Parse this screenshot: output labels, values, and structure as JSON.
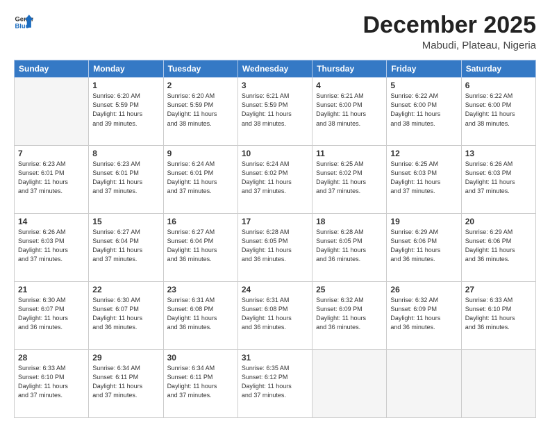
{
  "header": {
    "logo_general": "General",
    "logo_blue": "Blue",
    "month_title": "December 2025",
    "location": "Mabudi, Plateau, Nigeria"
  },
  "weekdays": [
    "Sunday",
    "Monday",
    "Tuesday",
    "Wednesday",
    "Thursday",
    "Friday",
    "Saturday"
  ],
  "weeks": [
    [
      {
        "day": "",
        "info": ""
      },
      {
        "day": "1",
        "info": "Sunrise: 6:20 AM\nSunset: 5:59 PM\nDaylight: 11 hours\nand 39 minutes."
      },
      {
        "day": "2",
        "info": "Sunrise: 6:20 AM\nSunset: 5:59 PM\nDaylight: 11 hours\nand 38 minutes."
      },
      {
        "day": "3",
        "info": "Sunrise: 6:21 AM\nSunset: 5:59 PM\nDaylight: 11 hours\nand 38 minutes."
      },
      {
        "day": "4",
        "info": "Sunrise: 6:21 AM\nSunset: 6:00 PM\nDaylight: 11 hours\nand 38 minutes."
      },
      {
        "day": "5",
        "info": "Sunrise: 6:22 AM\nSunset: 6:00 PM\nDaylight: 11 hours\nand 38 minutes."
      },
      {
        "day": "6",
        "info": "Sunrise: 6:22 AM\nSunset: 6:00 PM\nDaylight: 11 hours\nand 38 minutes."
      }
    ],
    [
      {
        "day": "7",
        "info": "Sunrise: 6:23 AM\nSunset: 6:01 PM\nDaylight: 11 hours\nand 37 minutes."
      },
      {
        "day": "8",
        "info": "Sunrise: 6:23 AM\nSunset: 6:01 PM\nDaylight: 11 hours\nand 37 minutes."
      },
      {
        "day": "9",
        "info": "Sunrise: 6:24 AM\nSunset: 6:01 PM\nDaylight: 11 hours\nand 37 minutes."
      },
      {
        "day": "10",
        "info": "Sunrise: 6:24 AM\nSunset: 6:02 PM\nDaylight: 11 hours\nand 37 minutes."
      },
      {
        "day": "11",
        "info": "Sunrise: 6:25 AM\nSunset: 6:02 PM\nDaylight: 11 hours\nand 37 minutes."
      },
      {
        "day": "12",
        "info": "Sunrise: 6:25 AM\nSunset: 6:03 PM\nDaylight: 11 hours\nand 37 minutes."
      },
      {
        "day": "13",
        "info": "Sunrise: 6:26 AM\nSunset: 6:03 PM\nDaylight: 11 hours\nand 37 minutes."
      }
    ],
    [
      {
        "day": "14",
        "info": "Sunrise: 6:26 AM\nSunset: 6:03 PM\nDaylight: 11 hours\nand 37 minutes."
      },
      {
        "day": "15",
        "info": "Sunrise: 6:27 AM\nSunset: 6:04 PM\nDaylight: 11 hours\nand 37 minutes."
      },
      {
        "day": "16",
        "info": "Sunrise: 6:27 AM\nSunset: 6:04 PM\nDaylight: 11 hours\nand 36 minutes."
      },
      {
        "day": "17",
        "info": "Sunrise: 6:28 AM\nSunset: 6:05 PM\nDaylight: 11 hours\nand 36 minutes."
      },
      {
        "day": "18",
        "info": "Sunrise: 6:28 AM\nSunset: 6:05 PM\nDaylight: 11 hours\nand 36 minutes."
      },
      {
        "day": "19",
        "info": "Sunrise: 6:29 AM\nSunset: 6:06 PM\nDaylight: 11 hours\nand 36 minutes."
      },
      {
        "day": "20",
        "info": "Sunrise: 6:29 AM\nSunset: 6:06 PM\nDaylight: 11 hours\nand 36 minutes."
      }
    ],
    [
      {
        "day": "21",
        "info": "Sunrise: 6:30 AM\nSunset: 6:07 PM\nDaylight: 11 hours\nand 36 minutes."
      },
      {
        "day": "22",
        "info": "Sunrise: 6:30 AM\nSunset: 6:07 PM\nDaylight: 11 hours\nand 36 minutes."
      },
      {
        "day": "23",
        "info": "Sunrise: 6:31 AM\nSunset: 6:08 PM\nDaylight: 11 hours\nand 36 minutes."
      },
      {
        "day": "24",
        "info": "Sunrise: 6:31 AM\nSunset: 6:08 PM\nDaylight: 11 hours\nand 36 minutes."
      },
      {
        "day": "25",
        "info": "Sunrise: 6:32 AM\nSunset: 6:09 PM\nDaylight: 11 hours\nand 36 minutes."
      },
      {
        "day": "26",
        "info": "Sunrise: 6:32 AM\nSunset: 6:09 PM\nDaylight: 11 hours\nand 36 minutes."
      },
      {
        "day": "27",
        "info": "Sunrise: 6:33 AM\nSunset: 6:10 PM\nDaylight: 11 hours\nand 36 minutes."
      }
    ],
    [
      {
        "day": "28",
        "info": "Sunrise: 6:33 AM\nSunset: 6:10 PM\nDaylight: 11 hours\nand 37 minutes."
      },
      {
        "day": "29",
        "info": "Sunrise: 6:34 AM\nSunset: 6:11 PM\nDaylight: 11 hours\nand 37 minutes."
      },
      {
        "day": "30",
        "info": "Sunrise: 6:34 AM\nSunset: 6:11 PM\nDaylight: 11 hours\nand 37 minutes."
      },
      {
        "day": "31",
        "info": "Sunrise: 6:35 AM\nSunset: 6:12 PM\nDaylight: 11 hours\nand 37 minutes."
      },
      {
        "day": "",
        "info": ""
      },
      {
        "day": "",
        "info": ""
      },
      {
        "day": "",
        "info": ""
      }
    ]
  ]
}
